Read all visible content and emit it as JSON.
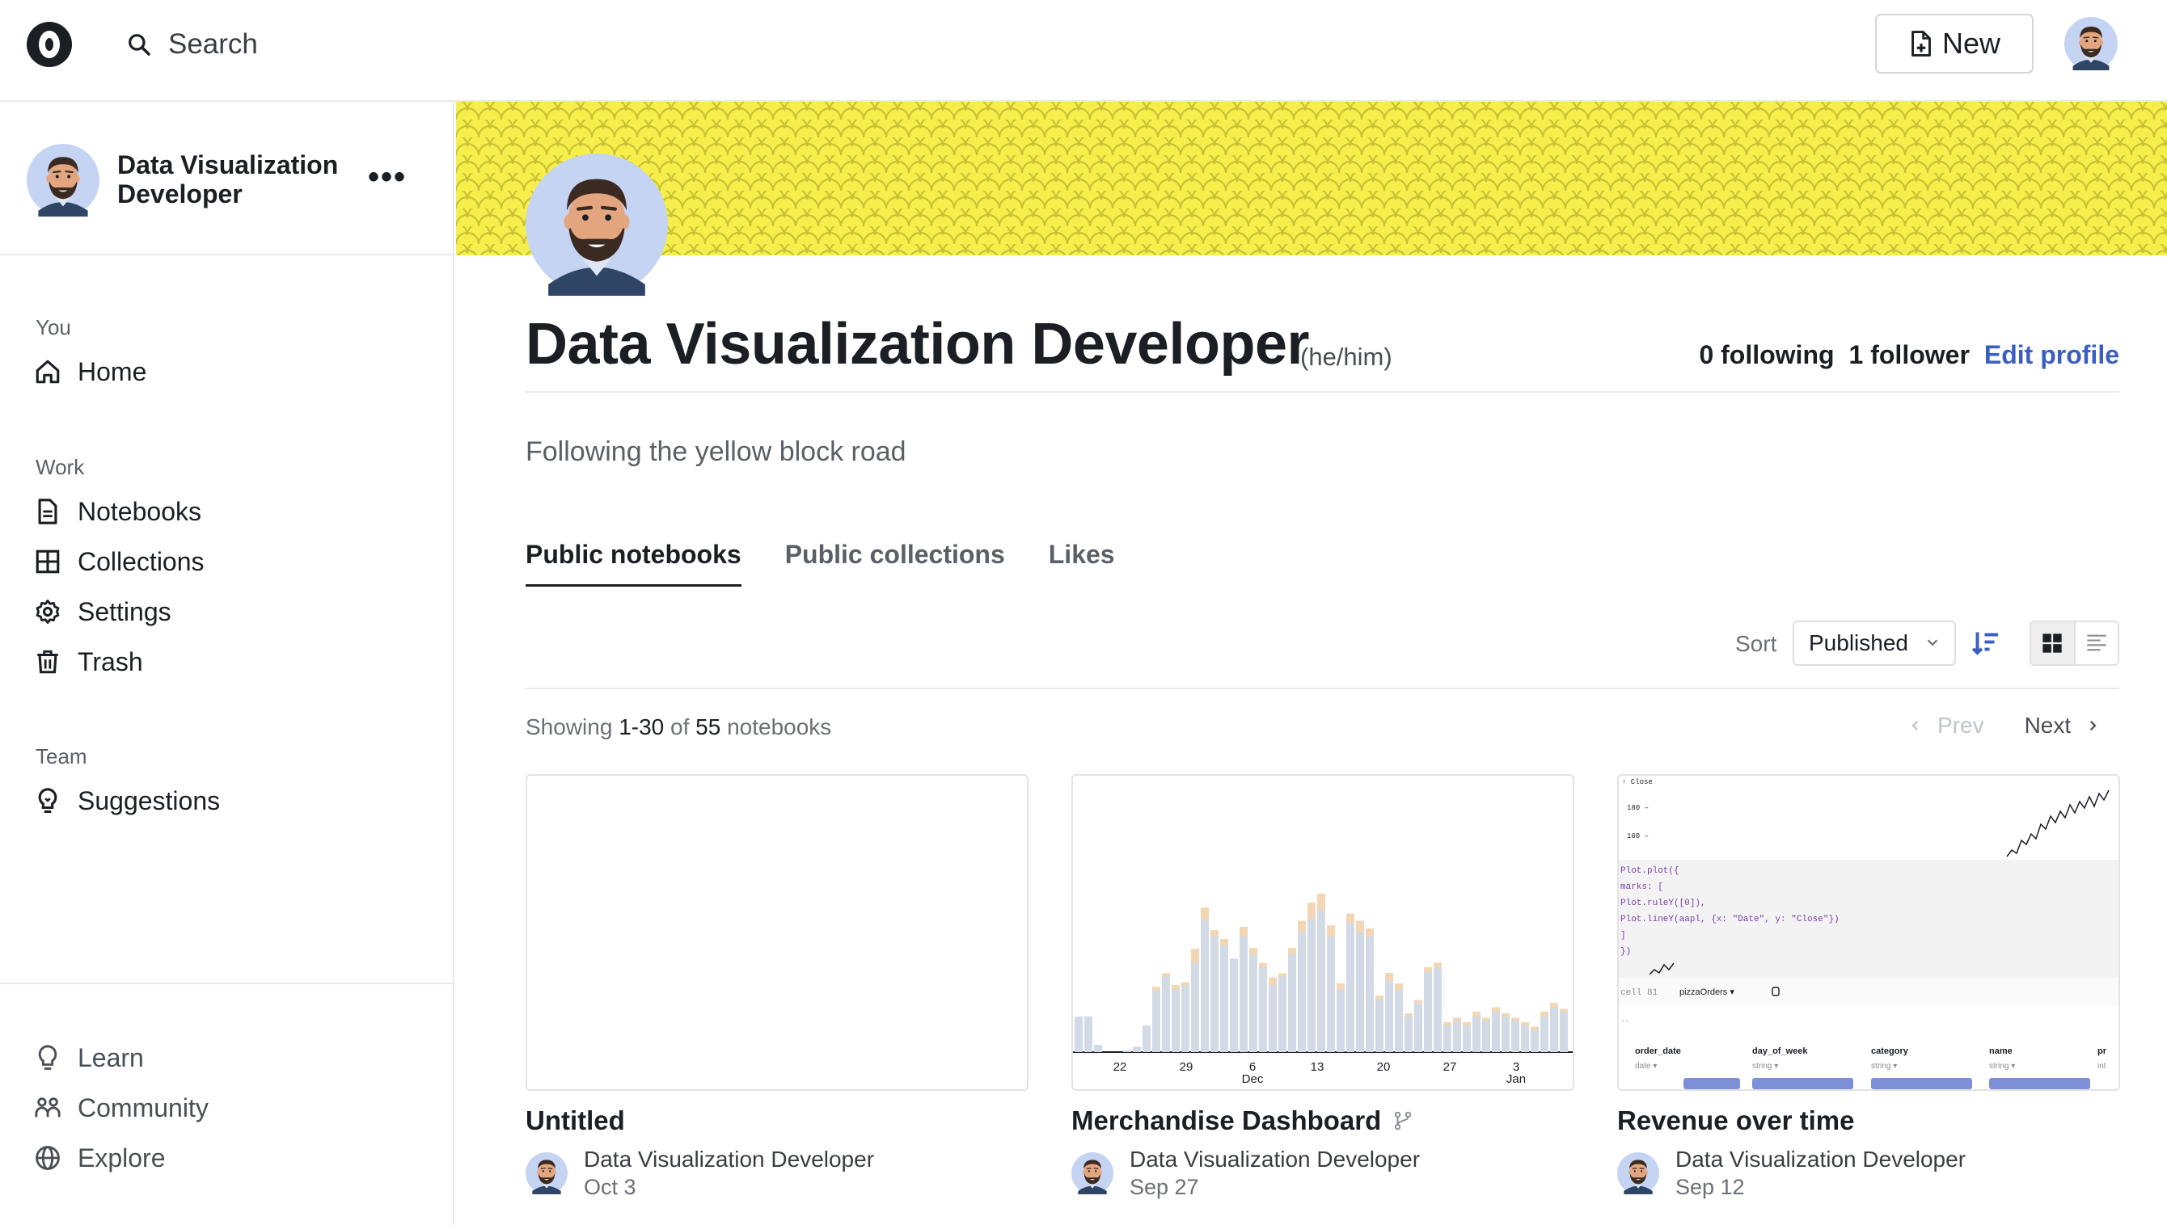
{
  "topbar": {
    "search_label": "Search",
    "new_label": "New"
  },
  "sidebar": {
    "user_name": "Data Visualization Developer",
    "more_label": "•••",
    "sections": {
      "you": "You",
      "work": "Work",
      "team": "Team"
    },
    "items": {
      "home": "Home",
      "notebooks": "Notebooks",
      "collections": "Collections",
      "settings": "Settings",
      "trash": "Trash",
      "suggestions": "Suggestions",
      "learn": "Learn",
      "community": "Community",
      "explore": "Explore"
    }
  },
  "profile": {
    "name": "Data Visualization Developer",
    "pronouns": "(he/him)",
    "following": "0 following",
    "followers": "1 follower",
    "edit_label": "Edit profile",
    "bio": "Following the yellow block road",
    "banner_color": "#f6ee4b"
  },
  "tabs": [
    {
      "label": "Public notebooks",
      "active": true
    },
    {
      "label": "Public collections",
      "active": false
    },
    {
      "label": "Likes",
      "active": false
    }
  ],
  "sort": {
    "label": "Sort",
    "selected": "Published"
  },
  "listing": {
    "showing_prefix": "Showing ",
    "range": "1-30",
    "of": " of ",
    "total": "55",
    "suffix": " notebooks",
    "prev_label": "Prev",
    "next_label": "Next"
  },
  "cards": [
    {
      "title": "Untitled",
      "author": "Data Visualization Developer",
      "date": "Oct 3"
    },
    {
      "title": "Merchandise Dashboard",
      "author": "Data Visualization Developer",
      "date": "Sep 27",
      "thumb_ticks": [
        "22",
        "29",
        "6",
        "13",
        "20",
        "27",
        "3"
      ],
      "thumb_tick_sub": [
        "",
        "",
        "Dec",
        "",
        "",
        "",
        "Jan"
      ]
    },
    {
      "title": "Revenue over time",
      "author": "Data Visualization Developer",
      "date": "Sep 12",
      "thumb": {
        "axis_label": "↑ Close",
        "y_ticks": [
          "180 –",
          "160 –"
        ],
        "code": [
          "Plot.plot({",
          "  marks: [",
          "    Plot.ruleY([0]),",
          "    Plot.lineY(aapl, {x: \"Date\", y: \"Close\"})",
          "  ]",
          "})"
        ],
        "cell_label": "cell 81",
        "cell_name": "pizzaOrders ▾",
        "columns": [
          {
            "name": "order_date",
            "type": "date ▾"
          },
          {
            "name": "day_of_week",
            "type": "string ▾"
          },
          {
            "name": "category",
            "type": "string ▾"
          },
          {
            "name": "name",
            "type": "string ▾"
          },
          {
            "name": "pr",
            "type": "int"
          }
        ]
      }
    }
  ],
  "colors": {
    "accent": "#3b5fc0",
    "bar_main": "#d2dae6",
    "bar_top": "#f3d7b4"
  }
}
